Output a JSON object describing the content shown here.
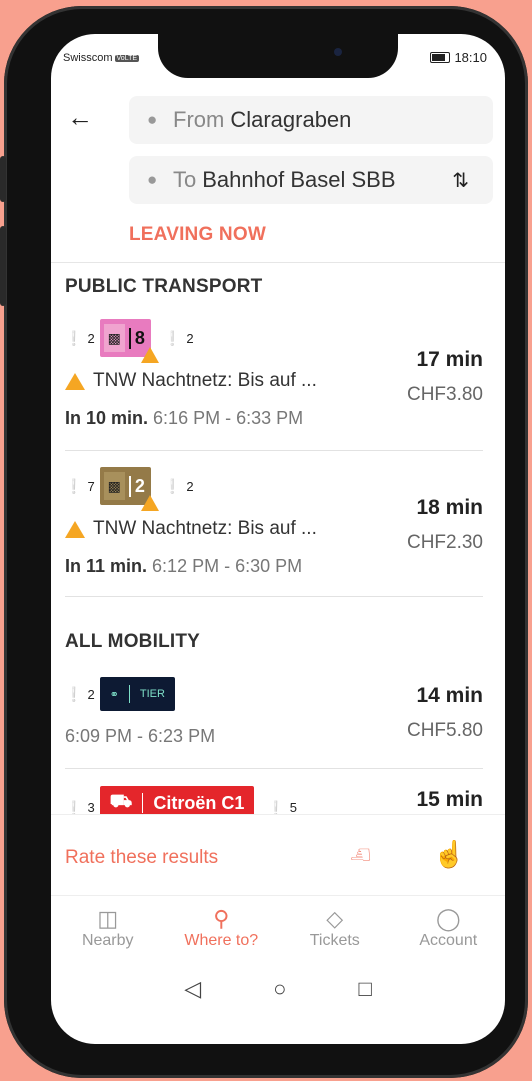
{
  "status": {
    "carrier": "Swisscom",
    "volte": "VoLTE",
    "time": "18:10"
  },
  "search": {
    "from_prefix": "From",
    "from_value": "Claragraben",
    "to_prefix": "To",
    "to_value": "Bahnhof Basel SBB",
    "leaving": "LEAVING NOW"
  },
  "sections": {
    "public": "PUBLIC TRANSPORT",
    "mobility": "ALL MOBILITY"
  },
  "results": [
    {
      "walk_before": "2",
      "line": "8",
      "walk_after": "2",
      "duration": "17 min",
      "price": "CHF3.80",
      "notice": "TNW Nachtnetz: Bis auf ...",
      "depart": "In 10 min.",
      "times": "6:16 PM - 6:33 PM"
    },
    {
      "walk_before": "7",
      "line": "2",
      "walk_after": "2",
      "duration": "18 min",
      "price": "CHF2.30",
      "notice": "TNW Nachtnetz: Bis auf ...",
      "depart": "In 11 min.",
      "times": "6:12 PM - 6:30 PM"
    },
    {
      "walk_before": "2",
      "provider": "TIER",
      "duration": "14 min",
      "price": "CHF5.80",
      "times": "6:09 PM - 6:23 PM"
    },
    {
      "walk_before": "3",
      "provider": "Citroën C1",
      "walk_after": "5",
      "duration": "15 min"
    }
  ],
  "rating": {
    "label": "Rate these results"
  },
  "tabs": [
    {
      "label": "Nearby",
      "icon": "map-icon"
    },
    {
      "label": "Where to?",
      "icon": "search-icon"
    },
    {
      "label": "Tickets",
      "icon": "ticket-icon"
    },
    {
      "label": "Account",
      "icon": "person-icon"
    }
  ],
  "colors": {
    "accent": "#f0705c",
    "warning": "#f5a623",
    "tram8": "#e87bbf",
    "tram2": "#947a48",
    "tier": "#0d1a33",
    "citroen": "#e4262b"
  }
}
